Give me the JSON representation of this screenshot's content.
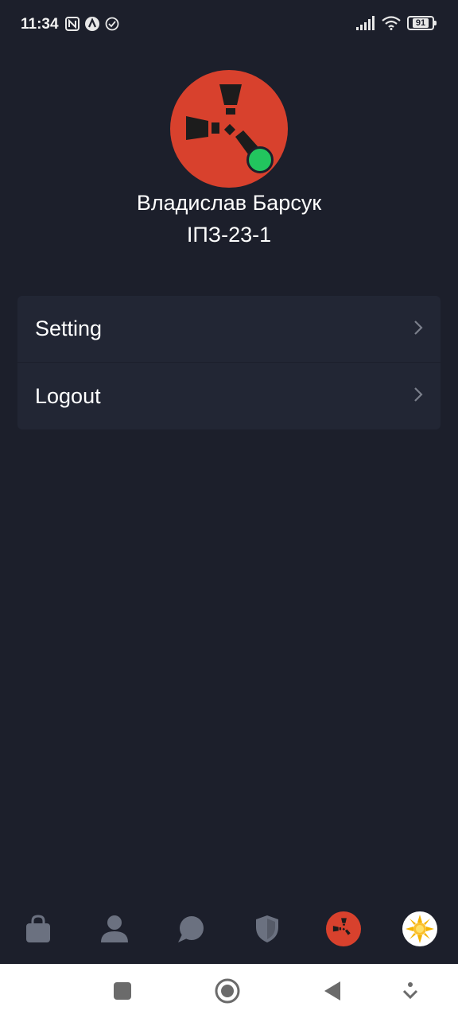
{
  "status_bar": {
    "time": "11:34",
    "battery": "91"
  },
  "profile": {
    "name": "Владислав Барсук",
    "group": "ІПЗ-23-1",
    "online": true,
    "avatar_color": "#d8412d",
    "online_color": "#22c55e"
  },
  "menu": {
    "items": [
      {
        "label": "Setting",
        "icon": "chevron-right-icon"
      },
      {
        "label": "Logout",
        "icon": "chevron-right-icon"
      }
    ]
  },
  "tab_bar": {
    "tabs": [
      {
        "name": "shop",
        "icon": "shopping-bag-icon",
        "active": false
      },
      {
        "name": "profile",
        "icon": "person-icon",
        "active": false
      },
      {
        "name": "chat",
        "icon": "chat-bubble-icon",
        "active": false
      },
      {
        "name": "security",
        "icon": "shield-icon",
        "active": false
      },
      {
        "name": "rust",
        "icon": "rust-logo-icon",
        "active": true
      },
      {
        "name": "theme",
        "icon": "sun-icon",
        "active": false
      }
    ]
  },
  "colors": {
    "background": "#1c1f2b",
    "menu_background": "#222634",
    "tab_icon": "#6b7180"
  }
}
